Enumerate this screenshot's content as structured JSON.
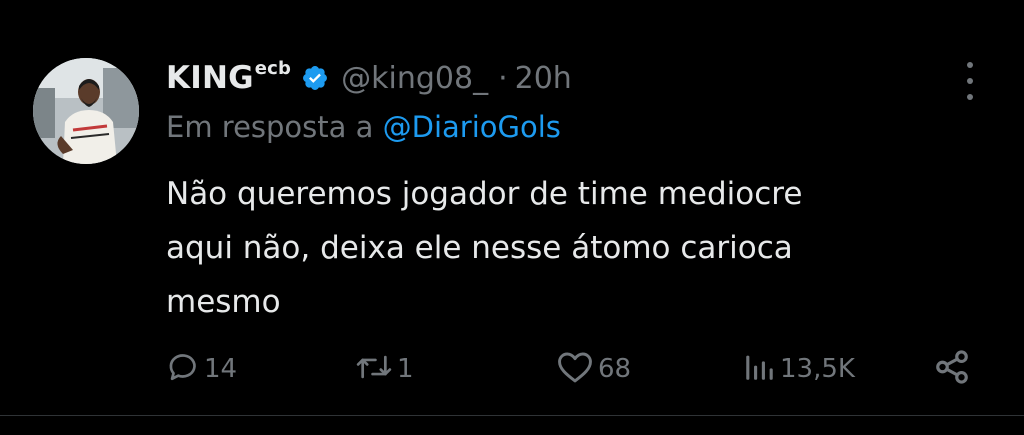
{
  "tweet": {
    "author_name": "KING",
    "author_name_sup": "ecb",
    "handle": "@king08_",
    "dot": "·",
    "time": "20h",
    "reply_prefix": "Em resposta a",
    "reply_to": "@DiarioGols",
    "text_lines": [
      "Não queremos jogador de time mediocre",
      "aqui não, deixa ele nesse átomo carioca",
      "mesmo"
    ]
  },
  "actions": {
    "replies": "14",
    "retweets": "1",
    "likes": "68",
    "views": "13,5K"
  },
  "colors": {
    "background": "#000000",
    "text": "#e7e9ea",
    "muted": "#71767b",
    "link": "#1d9bf0",
    "verified": "#1d9bf0",
    "divider": "#2f3336"
  },
  "icons": [
    "verified-badge-icon",
    "more-options-icon",
    "reply-icon",
    "retweet-icon",
    "like-icon",
    "views-icon",
    "share-icon"
  ]
}
